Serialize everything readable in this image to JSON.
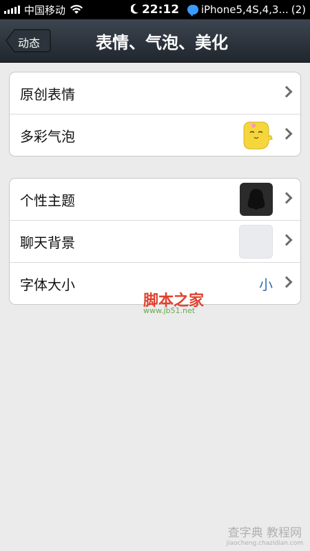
{
  "status_bar": {
    "carrier": "中国移动",
    "time": "22:12",
    "device_label": "iPhone5,4S,4,3...",
    "notification_count": "(2)"
  },
  "nav": {
    "back_label": "动态",
    "title": "表情、气泡、美化"
  },
  "group1": [
    {
      "label": "原创表情"
    },
    {
      "label": "多彩气泡"
    }
  ],
  "group2": [
    {
      "label": "个性主题"
    },
    {
      "label": "聊天背景"
    },
    {
      "label": "字体大小",
      "value": "小"
    }
  ],
  "watermark": {
    "main": "脚本之家",
    "sub": "www.jb51.net"
  },
  "footer_watermark": {
    "top": "查字典 教程网",
    "bottom": "jiaocheng.chazidian.com"
  },
  "icons": {
    "signal": "signal-bars-icon",
    "wifi": "wifi-icon",
    "moon": "moon-icon",
    "chat": "chat-bubble-icon",
    "chevron": "chevron-right-icon"
  },
  "colors": {
    "nav_bg": "#2a3038",
    "value_blue": "#2f6fb0",
    "chat_blue": "#3a9bff"
  }
}
